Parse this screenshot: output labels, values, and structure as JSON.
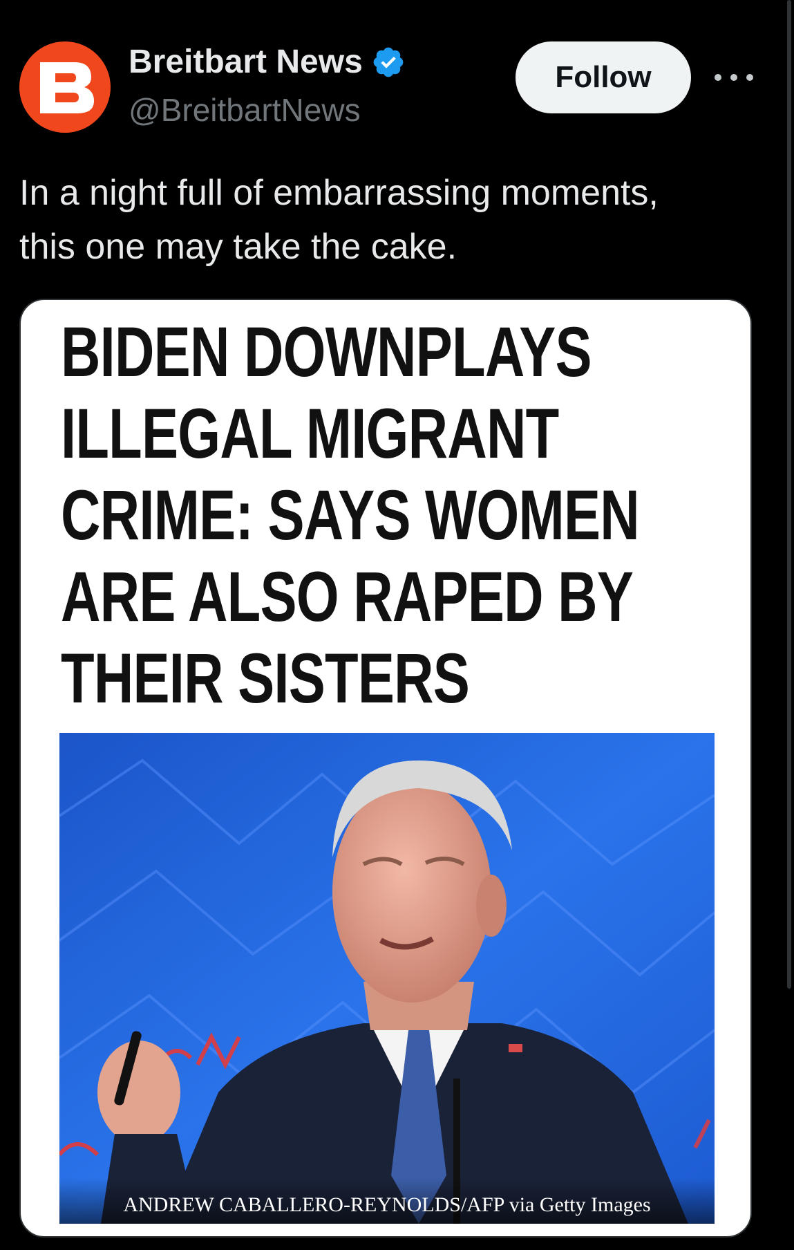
{
  "author": {
    "display_name": "Breitbart News",
    "handle": "@BreitbartNews",
    "avatar_letter": "B",
    "avatar_color": "#f1471d",
    "verified": true,
    "verified_color": "#1d9bf0"
  },
  "actions": {
    "follow_label": "Follow",
    "more_icon": "more-horizontal-icon"
  },
  "tweet": {
    "text_lines": [
      "In a night full of embarrassing moments,",
      "this one may take the cake."
    ]
  },
  "media": {
    "headline_lines": [
      "BIDEN DOWNPLAYS",
      "ILLEGAL MIGRANT",
      "CRIME: SAYS WOMEN",
      "ARE ALSO RAPED BY",
      "THEIR SISTERS"
    ],
    "photo_credit": "ANDREW CABALLERO-REYNOLDS/AFP via Getty Images",
    "photo_background_color": "#1f63d6"
  },
  "colors": {
    "background": "#000000",
    "text_primary": "#e7e9ea",
    "text_secondary": "#71767b",
    "follow_bg": "#eff3f4"
  }
}
